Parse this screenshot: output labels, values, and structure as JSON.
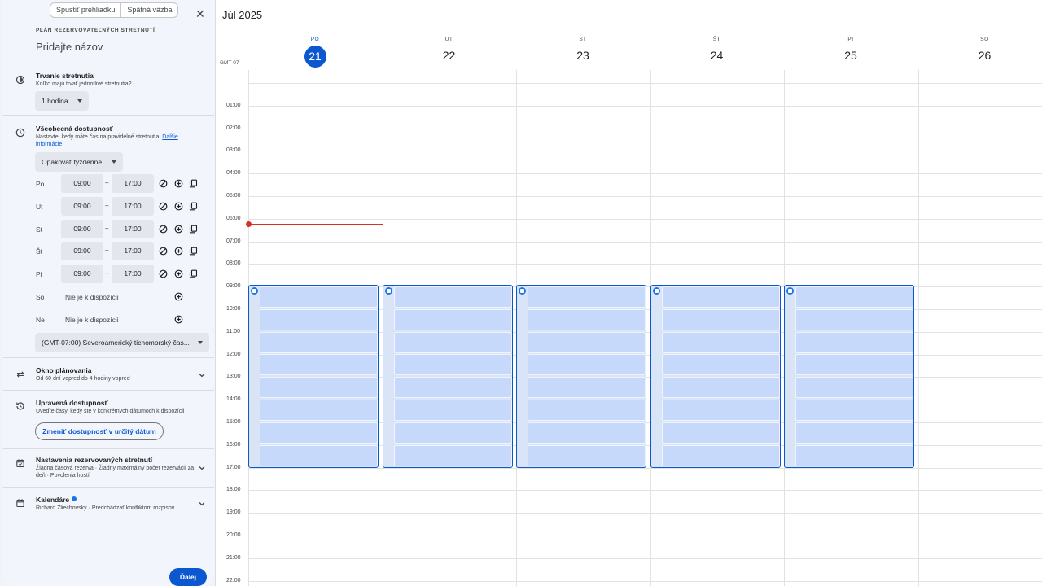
{
  "top_actions": {
    "tour": "Spustiť prehliadku",
    "feedback": "Spätná väzba"
  },
  "sidebar": {
    "kicker": "PLÁN REZERVOVATEĽNÝCH STRETNUTÍ",
    "title_placeholder": "Pridajte názov",
    "duration": {
      "title": "Trvanie stretnutia",
      "subtitle": "Koľko majú trvať jednotlivé stretnutia?",
      "value": "1 hodina"
    },
    "general": {
      "title": "Všeobecná dostupnosť",
      "subtitle": "Nastavte, kedy máte čas na pravidelné stretnutia.",
      "link": "Ďalšie informácie",
      "repeat": "Opakovať týždenne",
      "days": [
        {
          "label": "Po",
          "start": "09:00",
          "end": "17:00",
          "available": true
        },
        {
          "label": "Ut",
          "start": "09:00",
          "end": "17:00",
          "available": true
        },
        {
          "label": "St",
          "start": "09:00",
          "end": "17:00",
          "available": true
        },
        {
          "label": "Št",
          "start": "09:00",
          "end": "17:00",
          "available": true
        },
        {
          "label": "Pi",
          "start": "09:00",
          "end": "17:00",
          "available": true
        },
        {
          "label": "So",
          "unavailable_text": "Nie je k dispozícii",
          "available": false
        },
        {
          "label": "Ne",
          "unavailable_text": "Nie je k dispozícii",
          "available": false
        }
      ],
      "dash": "–",
      "timezone": "(GMT-07:00) Severoamerický tichomorský čas..."
    },
    "window": {
      "title": "Okno plánovania",
      "subtitle": "Od 60 dní vopred do 4 hodiny vopred"
    },
    "adjusted": {
      "title": "Upravená dostupnosť",
      "subtitle": "Uveďte časy, kedy ste v konkrétnych dátumoch k dispozícii",
      "button": "Zmeniť dostupnosť v určitý dátum"
    },
    "settings": {
      "title": "Nastavenia rezervovaných stretnutí",
      "subtitle": "Žiadna časová rezerva · Žiadny maximálny počet rezervácií za deň · Povolenia hostí"
    },
    "calendars": {
      "title": "Kalendáre",
      "subtitle": "Richard Zliechovský · Predchádzať konfliktom rozpisov"
    },
    "next": "Ďalej"
  },
  "calendar": {
    "month": "Júl 2025",
    "timezone": "GMT-07",
    "days": [
      {
        "dow": "PO",
        "num": "21",
        "today": true
      },
      {
        "dow": "UT",
        "num": "22",
        "today": false
      },
      {
        "dow": "ST",
        "num": "23",
        "today": false
      },
      {
        "dow": "ŠT",
        "num": "24",
        "today": false
      },
      {
        "dow": "PI",
        "num": "25",
        "today": false
      },
      {
        "dow": "SO",
        "num": "26",
        "today": false
      }
    ],
    "hours": [
      "01:00",
      "02:00",
      "03:00",
      "04:00",
      "05:00",
      "06:00",
      "07:00",
      "08:00",
      "09:00",
      "10:00",
      "11:00",
      "12:00",
      "13:00",
      "14:00",
      "15:00",
      "16:00",
      "17:00",
      "18:00",
      "19:00",
      "20:00",
      "21:00",
      "22:00"
    ],
    "available_blocks": {
      "days": [
        0,
        1,
        2,
        3,
        4
      ],
      "start": "09:00",
      "end": "17:00"
    }
  },
  "colors": {
    "accent": "#0b57d0",
    "now_line": "#d93025",
    "slot": "#c7d9fb"
  }
}
